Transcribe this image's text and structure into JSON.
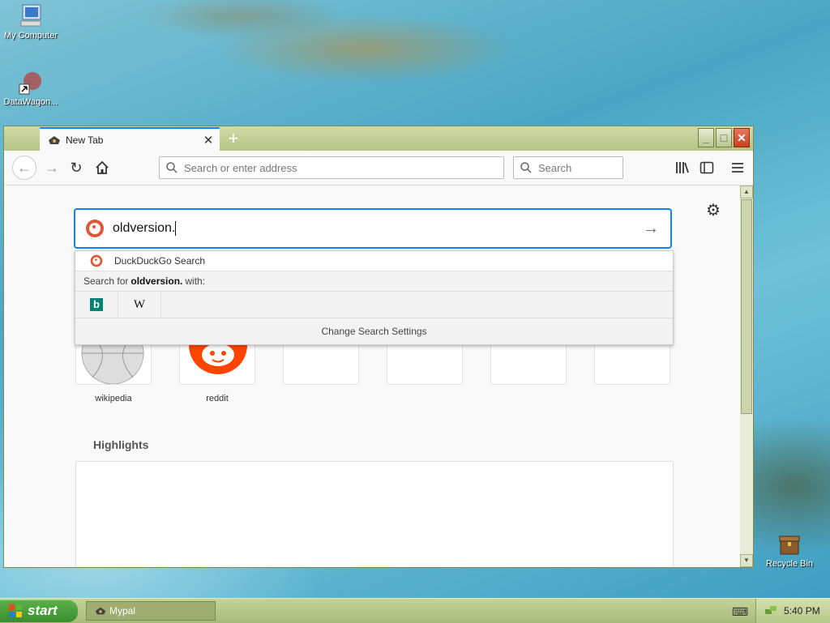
{
  "desktop": {
    "icons": [
      {
        "label": "My Computer"
      },
      {
        "label": "DataWagon..."
      },
      {
        "label": "Recycle Bin"
      }
    ]
  },
  "browser": {
    "tab": {
      "title": "New Tab",
      "close": "✕"
    },
    "new_tab": "+",
    "window_buttons": {
      "minimize": "_",
      "maximize": "□",
      "close": "✕"
    },
    "urlbar": {
      "placeholder": "Search or enter address"
    },
    "searchbar": {
      "placeholder": "Search"
    }
  },
  "newtab": {
    "search": {
      "value": "oldversion."
    },
    "dropdown": {
      "engine_label": "DuckDuckGo Search",
      "search_for_prefix": "Search for",
      "search_for_term": "oldversion.",
      "search_for_suffix": "with:",
      "engines": [
        "b",
        "W"
      ],
      "settings_label": "Change Search Settings"
    },
    "top_sites": [
      {
        "label": "wikipedia"
      },
      {
        "label": "reddit"
      },
      {
        "label": ""
      },
      {
        "label": ""
      },
      {
        "label": ""
      },
      {
        "label": ""
      }
    ],
    "highlights_title": "Highlights"
  },
  "taskbar": {
    "start_label": "start",
    "items": [
      {
        "label": "Mypal"
      }
    ],
    "clock": "5:40 PM"
  },
  "colors": {
    "accent": "#0a84ff",
    "bing": "#008373",
    "reddit": "#ff4500"
  }
}
